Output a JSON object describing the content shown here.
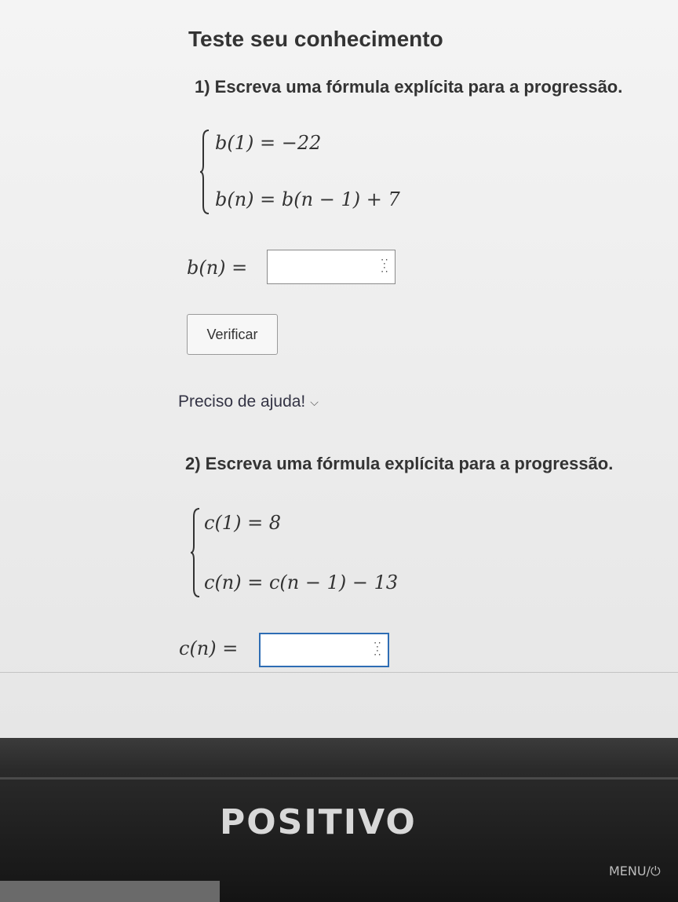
{
  "page_title": "Teste seu conhecimento",
  "question1": {
    "prompt": "1) Escreva uma fórmula explícita para a progressão.",
    "eq1": "b(1) = −22",
    "eq2": "b(n) = b(n − 1) + 7",
    "answer_label": "b(n) =",
    "answer_value": "",
    "check_label": "Verificar",
    "help_label": "Preciso de ajuda!"
  },
  "question2": {
    "prompt": "2) Escreva uma fórmula explícita para a progressão.",
    "eq1": "c(1) = 8",
    "eq2": "c(n) = c(n − 1) − 13",
    "answer_label": "c(n) =",
    "answer_value": ""
  },
  "icons": {
    "math_keypad": "math-keypad-icon",
    "chevron": "chevron-down-icon"
  },
  "bezel": {
    "brand": "POSITIVO",
    "menu_label": "MENU/⏻"
  },
  "colors": {
    "focus_border": "#2e6db4"
  }
}
